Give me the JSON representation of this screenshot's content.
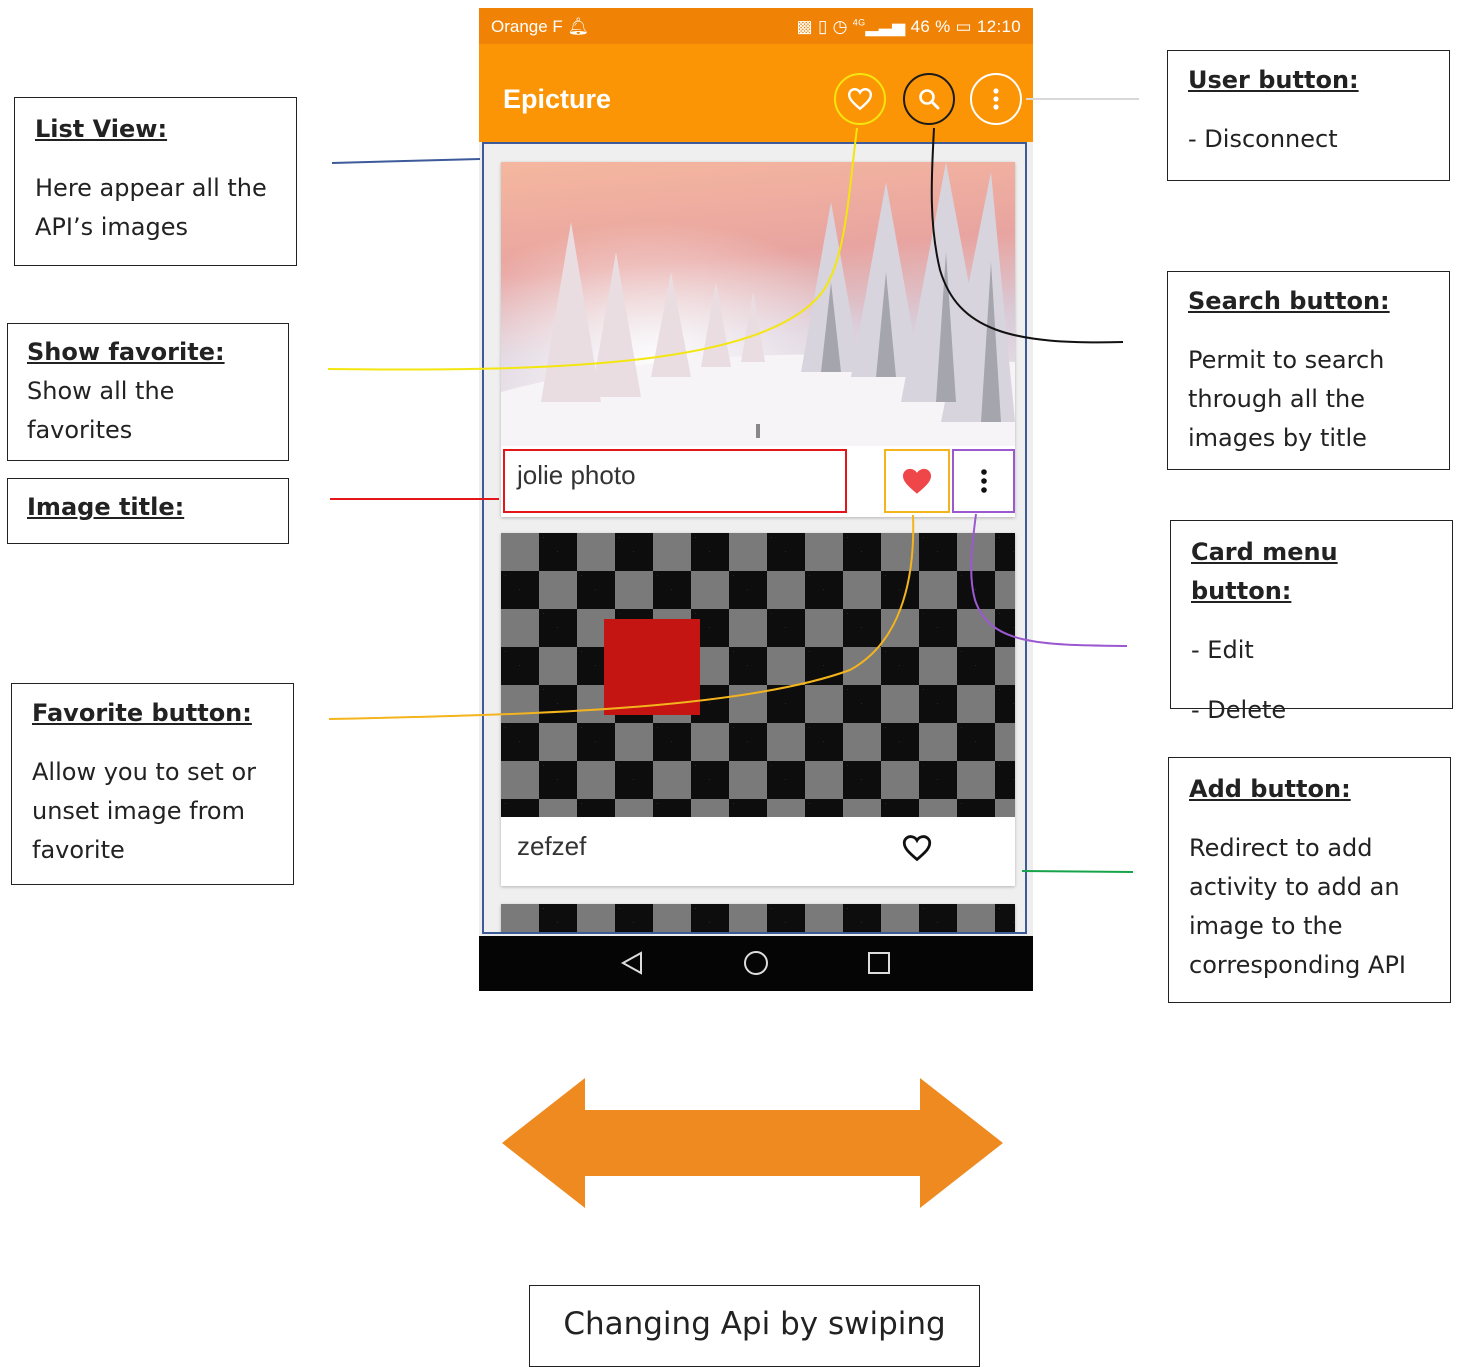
{
  "status_bar": {
    "carrier": "Orange F",
    "signal": "4G",
    "battery": "46 %",
    "time": "12:10"
  },
  "app_bar": {
    "title": "Epicture",
    "show_favorites_icon": "heart-outline-icon",
    "search_icon": "search-icon",
    "user_menu_icon": "more-vertical-icon"
  },
  "cards": [
    {
      "title": "jolie photo",
      "favorite": true,
      "image": "snowy forest photo"
    },
    {
      "title": "zefzef",
      "favorite": false,
      "image": "checkerboard with red square"
    }
  ],
  "fab": {
    "label": "+"
  },
  "callouts": {
    "list_view": {
      "heading": "List View:",
      "lines": [
        "Here appear all the API’s images"
      ]
    },
    "show_favorite": {
      "heading": "Show favorite:",
      "lines": [
        "Show all the favorites"
      ]
    },
    "image_title": {
      "heading": "Image title:"
    },
    "favorite_button": {
      "heading": "Favorite button:",
      "lines": [
        "Allow you to set or unset image from favorite"
      ]
    },
    "user_button": {
      "heading": "User button:",
      "lines": [
        "- Disconnect"
      ]
    },
    "search_button": {
      "heading": "Search button:",
      "lines": [
        "Permit to search through all the images by title"
      ]
    },
    "card_menu_button": {
      "heading": "Card menu button:",
      "lines": [
        "- Edit",
        "- Delete"
      ]
    },
    "add_button": {
      "heading": "Add button:",
      "lines": [
        "Redirect to add activity to add an image to the corresponding API"
      ]
    },
    "swipe": {
      "text": "Changing Api by swiping"
    }
  },
  "colors": {
    "app_bar": "#fb9505",
    "status_bar": "#f08306",
    "swipe_arrow": "#ee8a1f",
    "list_view_line": "#3d5a99",
    "show_favorite_line": "#f3e60e",
    "image_title_line": "#e3171a",
    "favorite_button_line": "#f4b41d",
    "card_menu_line": "#9b59d0",
    "add_button_line": "#16a34a"
  }
}
